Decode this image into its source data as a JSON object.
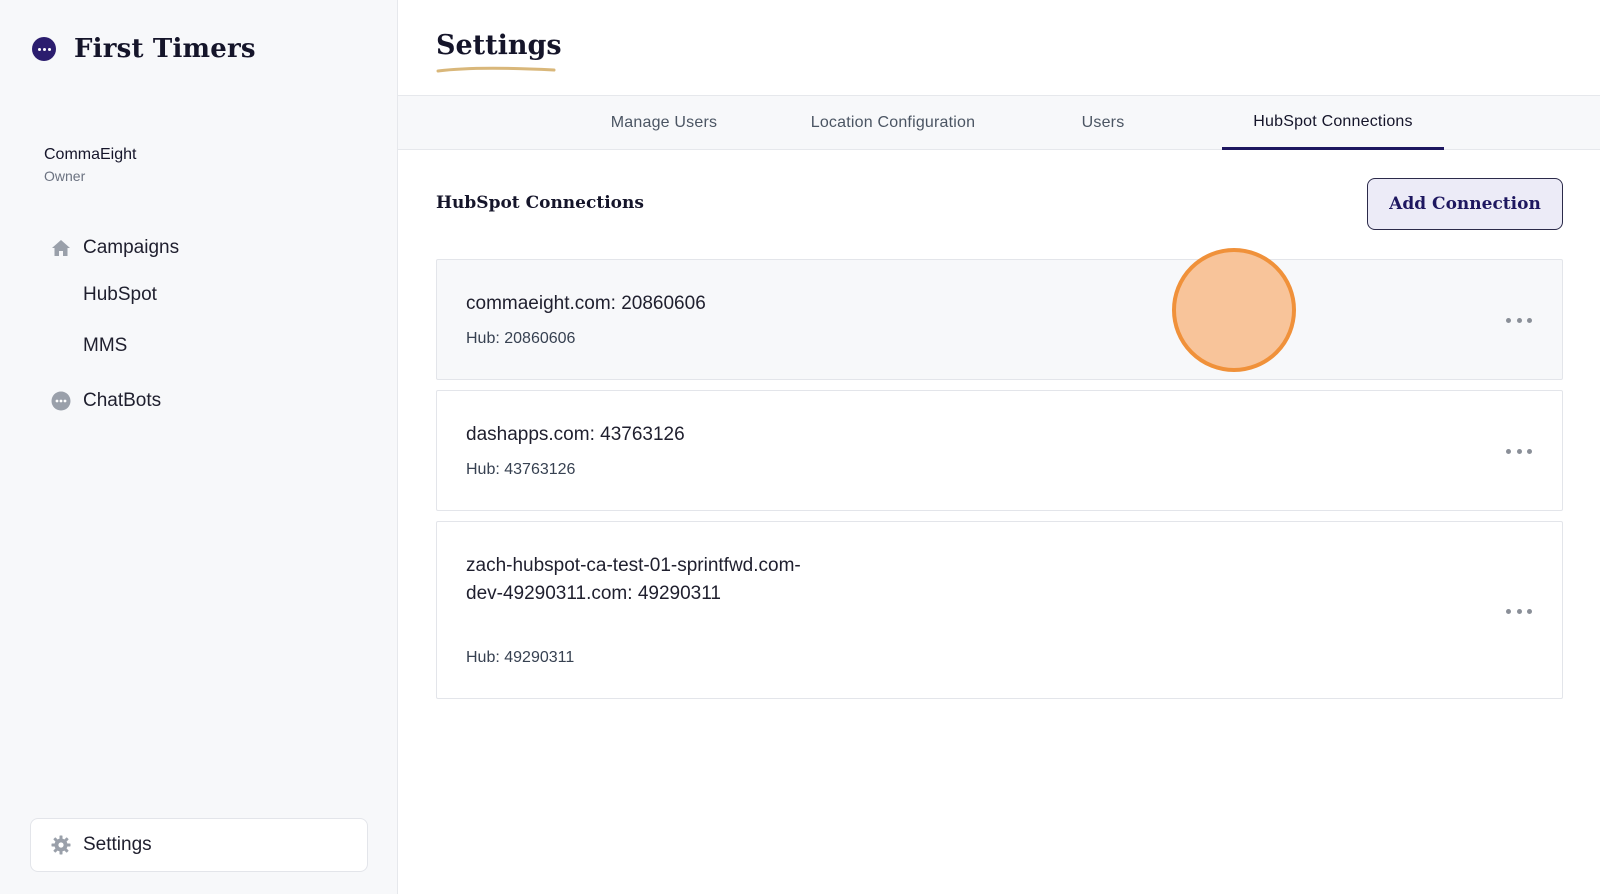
{
  "brand": {
    "name": "First Timers",
    "icon": "chat-bubble-dots-icon"
  },
  "account": {
    "name": "CommaEight",
    "role": "Owner"
  },
  "sidebar": {
    "items": [
      {
        "label": "Campaigns",
        "icon": "home-icon"
      },
      {
        "label": "HubSpot"
      },
      {
        "label": "MMS"
      },
      {
        "label": "ChatBots",
        "icon": "chat-dots-icon"
      }
    ],
    "settings": {
      "label": "Settings",
      "icon": "gear-icon"
    }
  },
  "page": {
    "title": "Settings"
  },
  "tabs": [
    {
      "label": "Manage Users",
      "active": false
    },
    {
      "label": "Location Configuration",
      "active": false
    },
    {
      "label": "Users",
      "active": false
    },
    {
      "label": "HubSpot Connections",
      "active": true
    }
  ],
  "section": {
    "title": "HubSpot Connections",
    "add_button": "Add Connection"
  },
  "connections": [
    {
      "name": "commaeight.com: 20860606",
      "hub": "Hub: 20860606"
    },
    {
      "name": "dashapps.com: 43763126",
      "hub": "Hub: 43763126"
    },
    {
      "name": "zach-hubspot-ca-test-01-sprintfwd.com-dev-49290311.com: 49290311",
      "hub": "Hub: 49290311"
    }
  ],
  "colors": {
    "accent": "#1e1760",
    "cursor_fill": "#f8c49a",
    "cursor_border": "#f0913a",
    "title_underline": "#d9b77a"
  }
}
